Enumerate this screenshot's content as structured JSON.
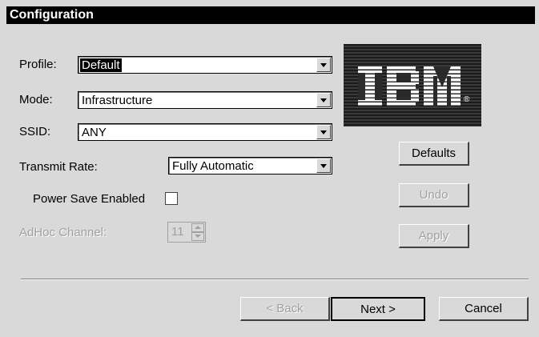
{
  "window": {
    "title": "Configuration"
  },
  "form": {
    "profile": {
      "label": "Profile:",
      "value": "Default"
    },
    "mode": {
      "label": "Mode:",
      "value": "Infrastructure"
    },
    "ssid": {
      "label": "SSID:",
      "value": "ANY"
    },
    "transmit_rate": {
      "label": "Transmit Rate:",
      "value": "Fully Automatic"
    },
    "power_save": {
      "label": "Power Save Enabled",
      "checked": false
    },
    "adhoc_channel": {
      "label": "AdHoc Channel:",
      "value": "11",
      "enabled": false
    }
  },
  "logo": {
    "text": "IBM",
    "registered_symbol": "®"
  },
  "side_buttons": {
    "defaults": "Defaults",
    "undo": "Undo",
    "apply": "Apply"
  },
  "nav_buttons": {
    "back": "< Back",
    "next": "Next >",
    "cancel": "Cancel"
  }
}
